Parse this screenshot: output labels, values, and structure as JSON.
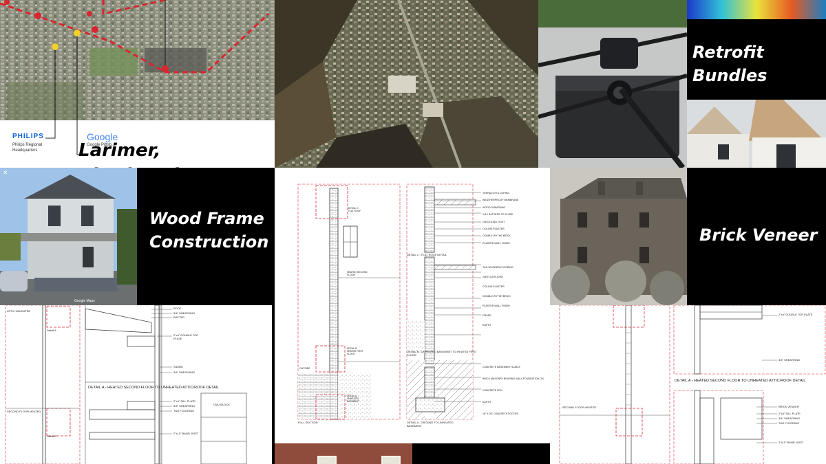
{
  "slide": {
    "map": {
      "caption": "Larimer, Pittsburgh, PA",
      "philips_logo": "PHILIPS",
      "philips_label": "Philips Regional Headquarters",
      "google_logo": "Google",
      "google_label": "Google Pittsb..."
    },
    "retrofit": {
      "line1": "Retrofit",
      "line2": "Bundles"
    },
    "wood": {
      "line1": "Wood Frame",
      "line2": "Construction",
      "streetview_badge": "Google Maps"
    },
    "brick": {
      "caption": "Brick Veneer"
    },
    "drawings": {
      "left_title": "DETAIL A - HEATED SECOND FLOOR TO UNHEATED ATTIC/ROOF DETAIL",
      "left_notes": [
        "ROOF",
        "3/4\" SHEATHING",
        "RAFTER",
        "2\"x4\" DOUBLE TOP PLATE",
        "SIDING",
        "3/4\" SHEATHING",
        "2\"x4\" SILL PLATE",
        "3/4\" SHEATHING",
        "T&G FLOORING",
        "2\"x10\" BAND JOIST",
        "CMU BLOCK"
      ],
      "left_side": [
        "ATTIC-UNHEATED",
        "Detail A",
        "SECOND FLOOR-HEATED",
        "Detail B"
      ],
      "center_labels": {
        "full_section": "FULL SECTION",
        "outside": "OUTSIDE",
        "detail_c": "DETAIL C - FLAT ROOF DETAIL",
        "detail_b": "DETAIL B - UNHEATED BASEMENT TO HEATED FIRST FLOOR",
        "detail_a": "DETAIL A - GROUND TO UNHEATED BASEMENT",
        "heated_floor": "HEATED SECOND FLOOR",
        "callout_c": "DETAIL C FLAT ROOF",
        "callout_b": "DETAIL B HEATED FIRST FLOOR",
        "callout_a": "DETAIL A UNHEATED BASEMENT"
      },
      "center_notes_c": [
        "TERRACOTTA COPING",
        "WEATHERPROOF MEMBRANE",
        "WOOD SHEATHING",
        "2x10 RAFTERS TO SLOPE",
        "2x8 CEILING JOIST",
        "CEILING PLASTER",
        "DOUBLE WYTHE BRICK",
        "PLASTER WALL FINISH"
      ],
      "center_notes_b": [
        "T&G WOODEN FLOORING",
        "2x8 FLOOR JOIST",
        "CEILING PLASTER",
        "DOUBLE WYTHE BRICK",
        "PLASTER WALL FINISH",
        "GRADE",
        "EARTH"
      ],
      "center_notes_a": [
        "CONCRETE BASEMENT SLAB 3\"",
        "BRICK MASONRY BEARING WALL FOUNDATION ON CONCRETE FDN",
        "EARTH",
        "18\" X 36\" CONCRETE FOOTER"
      ],
      "right_title": "DETAIL A - HEATED SECOND FLOOR TO UNHEATED ATTIC/ROOF DETAIL",
      "right_notes": [
        "2\"x4\" DOUBLE TOP PLATE",
        "3/4\" SHEATHING",
        "BRICK VENEER",
        "2\"x4\" SILL PLATE",
        "3/4\" SHEATHING",
        "T&G FLOORING",
        "2\"x10\" BAND JOIST"
      ],
      "right_side": [
        "SECOND FLOOR-HEATED"
      ]
    },
    "colors": {
      "accent_red": "#d9262f",
      "marker_yellow": "#f2d12b",
      "caption": "#ffffff",
      "black": "#000000"
    }
  }
}
